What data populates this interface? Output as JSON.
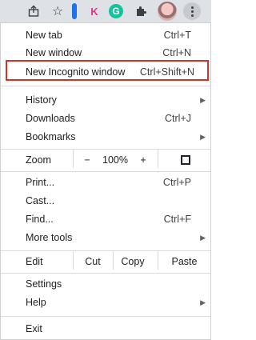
{
  "toolbar": {
    "share_icon": "share-icon",
    "star_icon": "star-icon",
    "ext_k_letter": "K",
    "ext_g_letter": "G",
    "puzzle_icon": "puzzle-icon",
    "avatar_icon": "avatar",
    "menu_icon": "kebab-menu-icon"
  },
  "menu": {
    "new_tab": {
      "label": "New tab",
      "shortcut": "Ctrl+T"
    },
    "new_window": {
      "label": "New window",
      "shortcut": "Ctrl+N"
    },
    "new_incognito": {
      "label": "New Incognito window",
      "shortcut": "Ctrl+Shift+N"
    },
    "history": {
      "label": "History"
    },
    "downloads": {
      "label": "Downloads",
      "shortcut": "Ctrl+J"
    },
    "bookmarks": {
      "label": "Bookmarks"
    },
    "zoom": {
      "label": "Zoom",
      "minus": "−",
      "value": "100%",
      "plus": "+"
    },
    "print": {
      "label": "Print...",
      "shortcut": "Ctrl+P"
    },
    "cast": {
      "label": "Cast..."
    },
    "find": {
      "label": "Find...",
      "shortcut": "Ctrl+F"
    },
    "more_tools": {
      "label": "More tools"
    },
    "edit": {
      "label": "Edit",
      "cut": "Cut",
      "copy": "Copy",
      "paste": "Paste"
    },
    "settings": {
      "label": "Settings"
    },
    "help": {
      "label": "Help"
    },
    "exit": {
      "label": "Exit"
    }
  },
  "colors": {
    "highlight_border": "#d93025",
    "toolbar_bg": "#dee1e6",
    "accent_blue": "#1a73e8"
  }
}
